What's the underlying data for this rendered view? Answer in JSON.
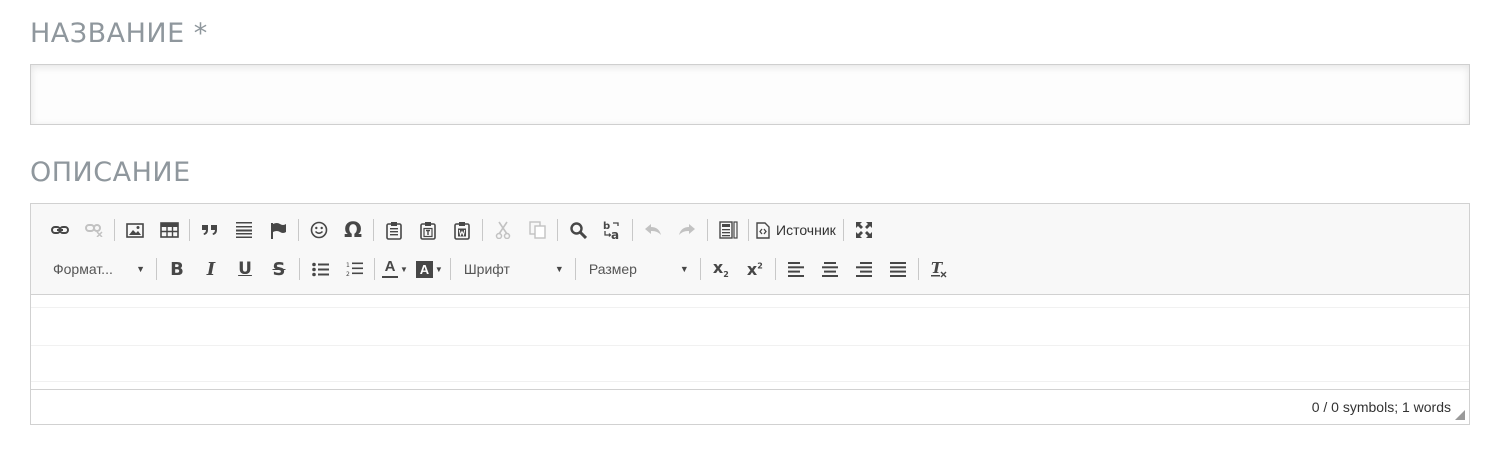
{
  "title_field": {
    "label": "НАЗВАНИЕ *",
    "value": "",
    "placeholder": ""
  },
  "description_field": {
    "label": "ОПИСАНИЕ"
  },
  "toolbar": {
    "source_label": "Источник",
    "format_label": "Формат...",
    "font_label": "Шрифт",
    "size_label": "Размер",
    "row1_icons": [
      "link-icon",
      "unlink-icon",
      "image-icon",
      "table-icon",
      "blockquote-icon",
      "horizontal-rule-icon",
      "anchor-flag-icon",
      "smiley-icon",
      "special-char-omega-icon",
      "paste-icon",
      "paste-text-icon",
      "paste-word-icon",
      "cut-icon",
      "copy-icon",
      "find-icon",
      "replace-icon",
      "undo-icon",
      "redo-icon",
      "templates-icon",
      "source-icon",
      "maximize-icon"
    ],
    "row2_icons": [
      "bold-icon",
      "italic-icon",
      "underline-icon",
      "strikethrough-icon",
      "bulleted-list-icon",
      "numbered-list-icon",
      "text-color-icon",
      "background-color-icon",
      "subscript-icon",
      "superscript-icon",
      "align-left-icon",
      "align-center-icon",
      "align-right-icon",
      "align-justify-icon",
      "remove-format-icon"
    ]
  },
  "status": {
    "counter": "0 / 0 symbols; 1 words"
  },
  "colors": {
    "label": "#8f979d",
    "icon": "#474747",
    "icon_disabled": "#c2c2c2",
    "toolbar_bg": "#f8f8f8",
    "border": "#d1d1d1"
  }
}
